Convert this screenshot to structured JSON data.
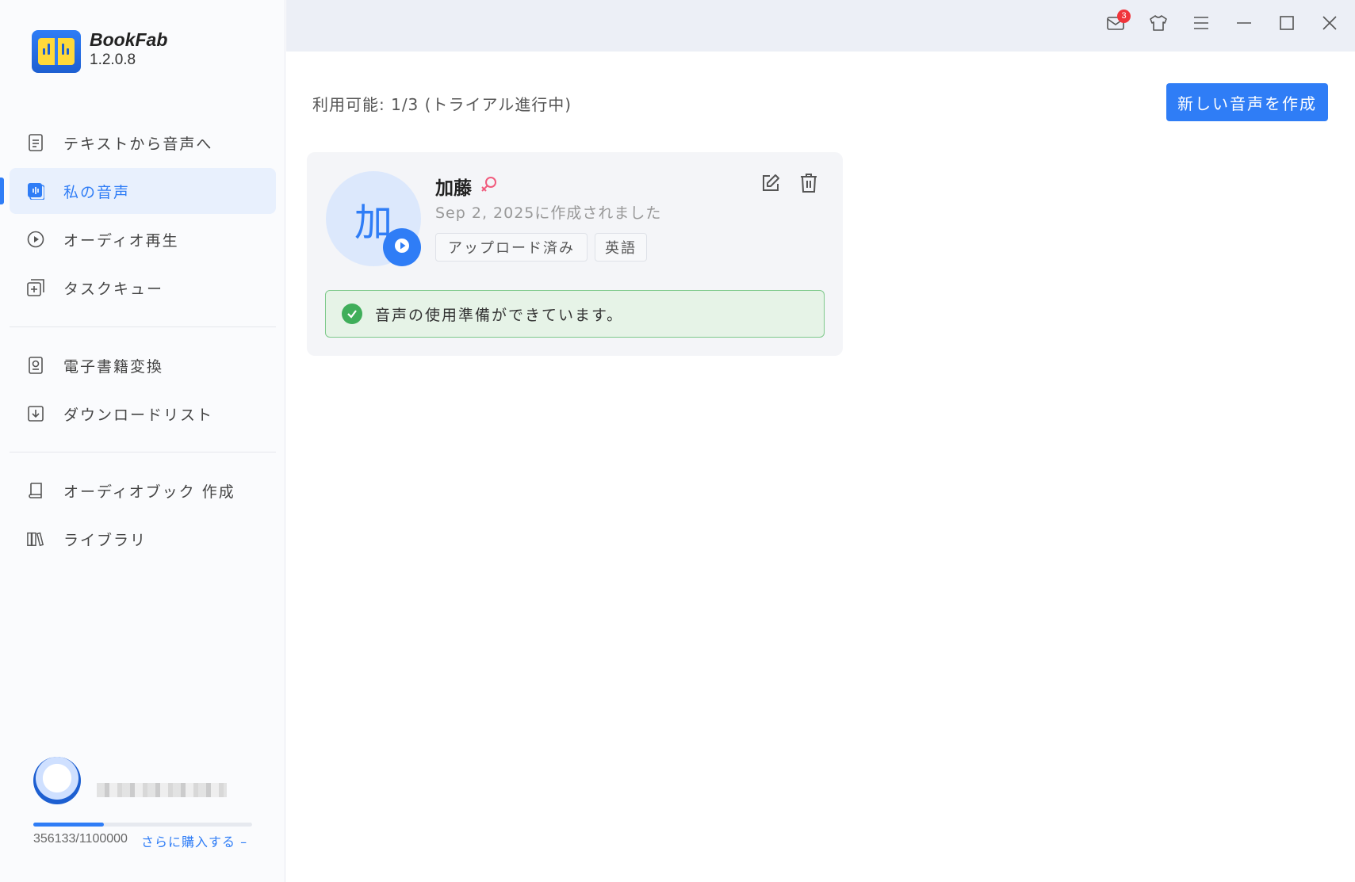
{
  "app": {
    "name": "BookFab",
    "version": "1.2.0.8"
  },
  "sidebar": {
    "items": [
      {
        "label": "テキストから音声へ",
        "icon": "document-icon"
      },
      {
        "label": "私の音声",
        "icon": "voice-icon",
        "active": true
      },
      {
        "label": "オーディオ再生",
        "icon": "play-circle-icon"
      },
      {
        "label": "タスクキュー",
        "icon": "task-queue-icon"
      },
      {
        "label": "電子書籍変換",
        "icon": "ebook-icon"
      },
      {
        "label": "ダウンロードリスト",
        "icon": "download-icon"
      },
      {
        "label": "オーディオブック 作成",
        "icon": "audiobook-icon"
      },
      {
        "label": "ライブラリ",
        "icon": "library-icon"
      }
    ],
    "quota": {
      "text": "356133/1100000",
      "used": 356133,
      "total": 1100000,
      "buy_more": "さらに購入する –"
    }
  },
  "titlebar": {
    "mail_badge": "3"
  },
  "main": {
    "availability": "利用可能: 1/3 (トライアル進行中)",
    "new_voice_button": "新しい音声を作成",
    "voice_card": {
      "avatar_char": "加",
      "name": "加藤",
      "created": "Sep 2, 2025に作成されました",
      "tags": [
        "アップロード済み",
        "英語"
      ],
      "status": "音声の使用準備ができています。"
    }
  },
  "colors": {
    "accent": "#2f7df6",
    "success": "#3fae5a",
    "badge": "#f0353b"
  }
}
